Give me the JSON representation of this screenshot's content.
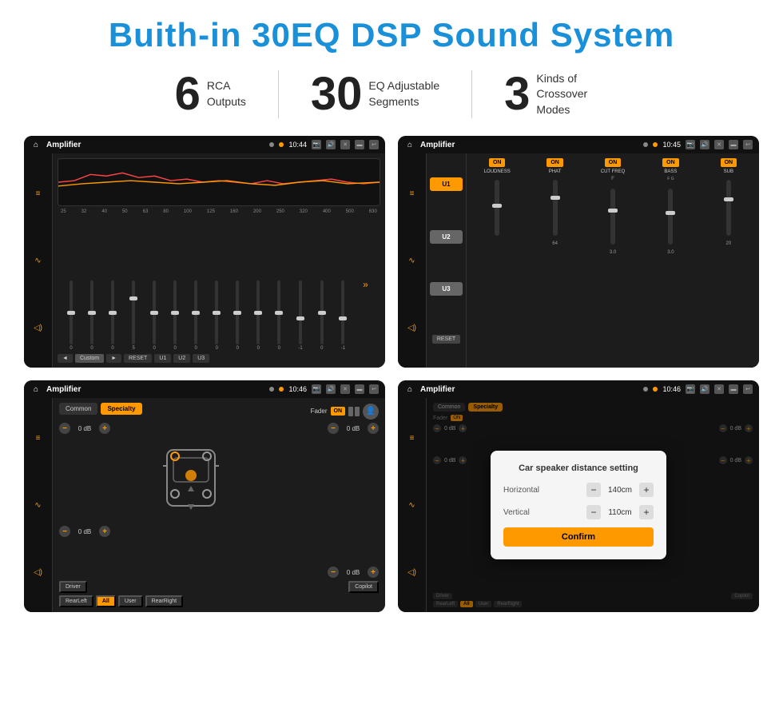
{
  "title": "Buith-in 30EQ DSP Sound System",
  "stats": [
    {
      "number": "6",
      "text": "RCA\nOutputs"
    },
    {
      "number": "30",
      "text": "EQ Adjustable\nSegments"
    },
    {
      "number": "3",
      "text": "Kinds of\nCrossover Modes"
    }
  ],
  "screens": [
    {
      "id": "screen1",
      "statusBar": {
        "title": "Amplifier",
        "time": "10:44"
      },
      "type": "eq",
      "freqLabels": [
        "25",
        "32",
        "40",
        "50",
        "63",
        "80",
        "100",
        "125",
        "160",
        "200",
        "250",
        "320",
        "400",
        "500",
        "630"
      ],
      "sliderValues": [
        "0",
        "0",
        "0",
        "5",
        "0",
        "0",
        "0",
        "0",
        "0",
        "0",
        "0",
        "-1",
        "0",
        "-1"
      ],
      "presets": [
        "Custom",
        "RESET",
        "U1",
        "U2",
        "U3"
      ]
    },
    {
      "id": "screen2",
      "statusBar": {
        "title": "Amplifier",
        "time": "10:45"
      },
      "type": "amp",
      "presets": [
        "U1",
        "U2",
        "U3"
      ],
      "channels": [
        {
          "name": "LOUDNESS",
          "on": true,
          "val": ""
        },
        {
          "name": "PHAT",
          "on": true,
          "val": ""
        },
        {
          "name": "CUT FREQ",
          "on": true,
          "val": ""
        },
        {
          "name": "BASS",
          "on": true,
          "val": ""
        },
        {
          "name": "SUB",
          "on": true,
          "val": ""
        }
      ]
    },
    {
      "id": "screen3",
      "statusBar": {
        "title": "Amplifier",
        "time": "10:46"
      },
      "type": "crossover",
      "tabs": [
        "Common",
        "Specialty"
      ],
      "faderLabel": "Fader",
      "faderOn": true,
      "volumes": {
        "frontLeft": "0 dB",
        "frontRight": "0 dB",
        "rearLeft": "0 dB",
        "rearRight": "0 dB"
      },
      "bottomButtons": [
        "Driver",
        "Copilot",
        "RearLeft",
        "All",
        "User",
        "RearRight"
      ]
    },
    {
      "id": "screen4",
      "statusBar": {
        "title": "Amplifier",
        "time": "10:46"
      },
      "type": "dialog",
      "dialog": {
        "title": "Car speaker distance setting",
        "rows": [
          {
            "label": "Horizontal",
            "value": "140cm"
          },
          {
            "label": "Vertical",
            "value": "110cm"
          }
        ],
        "confirmLabel": "Confirm"
      }
    }
  ]
}
